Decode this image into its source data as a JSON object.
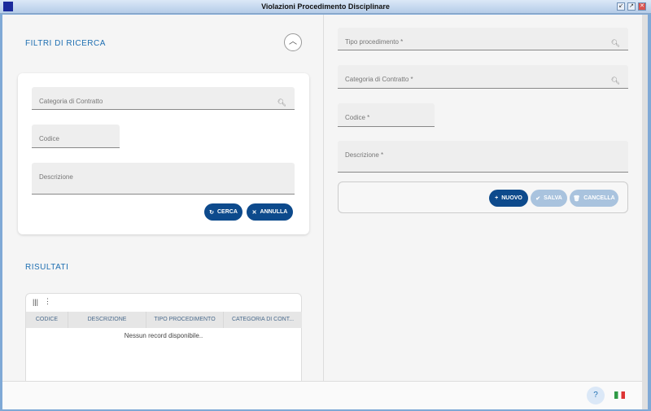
{
  "window": {
    "title": "Violazioni Procedimento Disciplinare"
  },
  "filters": {
    "title": "FILTRI DI RICERCA",
    "categoria": "Categoria di Contratto",
    "codice": "Codice",
    "descrizione": "Descrizione",
    "cerca": "CERCA",
    "annulla": "ANNULLA"
  },
  "results": {
    "title": "RISULTATI",
    "columns": [
      "CODICE",
      "DESCRIZIONE",
      "TIPO PROCEDIMENTO",
      "CATEGORIA DI CONT..."
    ],
    "empty": "Nessun record disponibile.."
  },
  "form": {
    "tipo": "Tipo procedimento *",
    "categoria": "Categoria di Contratto *",
    "codice": "Codice *",
    "descrizione": "Descrizione *",
    "nuovo": "NUOVO",
    "salva": "SALVA",
    "cancella": "CANCELLA"
  },
  "colors": {
    "primary": "#0d4a8c",
    "disabled": "#a9c3de",
    "section": "#1f6fb2"
  }
}
